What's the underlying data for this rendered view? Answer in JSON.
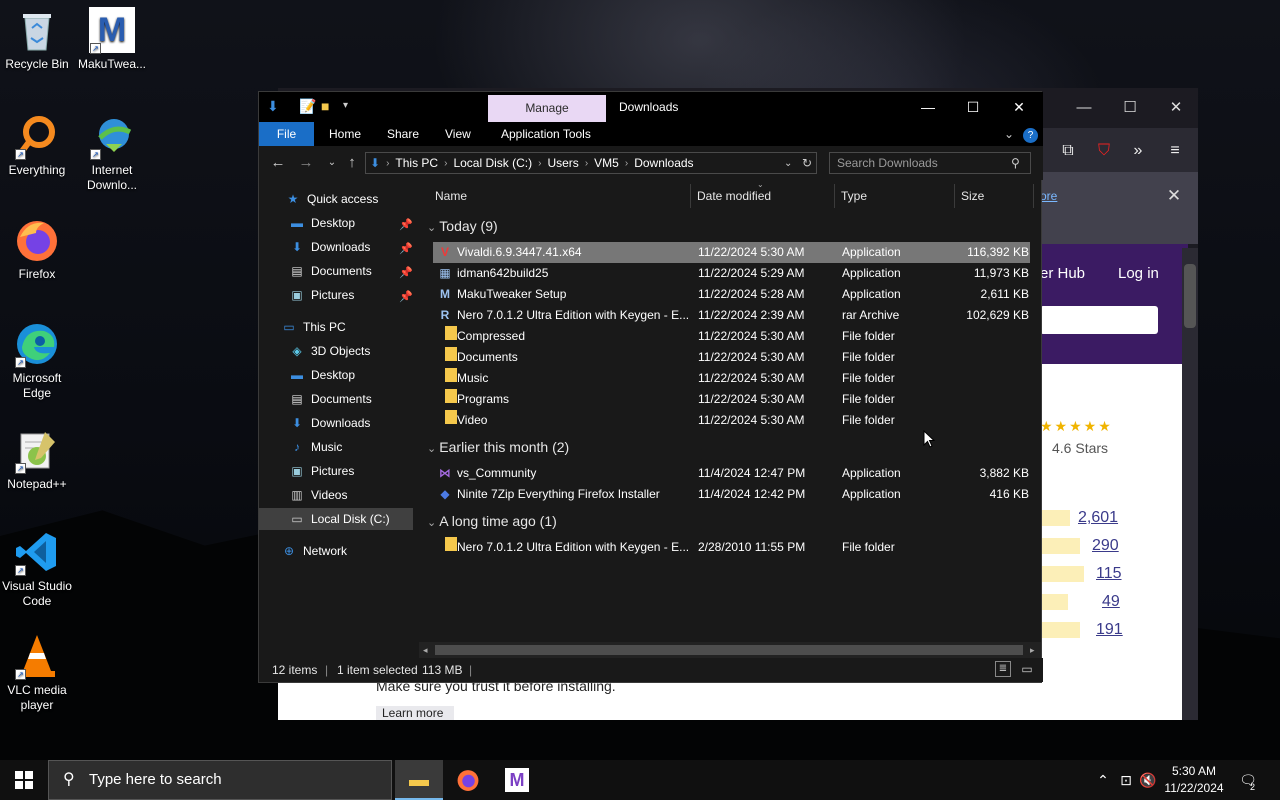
{
  "desktop": {
    "icons": [
      {
        "label": "Recycle Bin",
        "glyph": "🗑"
      },
      {
        "label": "MakuTwea...",
        "glyph": "M"
      },
      {
        "label": "Everything",
        "glyph": "○"
      },
      {
        "label": "Internet Downlo...",
        "glyph": "⬇"
      },
      {
        "label": "Firefox",
        "glyph": "🦊"
      },
      {
        "label": "Microsoft Edge",
        "glyph": "e"
      },
      {
        "label": "Notepad++",
        "glyph": "✎"
      },
      {
        "label": "Visual Studio Code",
        "glyph": "⟩"
      },
      {
        "label": "VLC media player",
        "glyph": "▲"
      }
    ]
  },
  "browser": {
    "more_link": "ore",
    "hub_text": "er Hub",
    "login": "Log in",
    "rating_stars": "★★★★★",
    "rating_text": "4.6 Stars",
    "counts": [
      "2,601",
      "290",
      "115",
      "49",
      "191"
    ],
    "footer_text": "Make sure you trust it before installing.",
    "learn_more": "Learn more"
  },
  "explorer": {
    "manage_tab": "Manage",
    "title": "Downloads",
    "ribbon_tabs": [
      "File",
      "Home",
      "Share",
      "View",
      "Application Tools"
    ],
    "breadcrumb": [
      "This PC",
      "Local Disk (C:)",
      "Users",
      "VM5",
      "Downloads"
    ],
    "search_placeholder": "Search Downloads",
    "nav": {
      "quick_access": "Quick access",
      "quick_items": [
        "Desktop",
        "Downloads",
        "Documents",
        "Pictures"
      ],
      "this_pc": "This PC",
      "pc_items": [
        "3D Objects",
        "Desktop",
        "Documents",
        "Downloads",
        "Music",
        "Pictures",
        "Videos",
        "Local Disk (C:)"
      ],
      "network": "Network"
    },
    "columns": {
      "name": "Name",
      "date": "Date modified",
      "type": "Type",
      "size": "Size"
    },
    "groups": [
      {
        "title": "Today (9)",
        "rows": [
          {
            "name": "Vivaldi.6.9.3447.41.x64",
            "date": "11/22/2024 5:30 AM",
            "type": "Application",
            "size": "116,392 KB",
            "icon": "V",
            "selected": true
          },
          {
            "name": "idman642build25",
            "date": "11/22/2024 5:29 AM",
            "type": "Application",
            "size": "11,973 KB",
            "icon": "▦",
            "selected": false
          },
          {
            "name": "MakuTweaker Setup",
            "date": "11/22/2024 5:28 AM",
            "type": "Application",
            "size": "2,611 KB",
            "icon": "M",
            "selected": false
          },
          {
            "name": "Nero 7.0.1.2 Ultra Edition with Keygen - E...",
            "date": "11/22/2024 2:39 AM",
            "type": "rar Archive",
            "size": "102,629 KB",
            "icon": "R",
            "selected": false
          },
          {
            "name": "Compressed",
            "date": "11/22/2024 5:30 AM",
            "type": "File folder",
            "size": "",
            "icon": "folder",
            "selected": false
          },
          {
            "name": "Documents",
            "date": "11/22/2024 5:30 AM",
            "type": "File folder",
            "size": "",
            "icon": "folder",
            "selected": false
          },
          {
            "name": "Music",
            "date": "11/22/2024 5:30 AM",
            "type": "File folder",
            "size": "",
            "icon": "folder",
            "selected": false
          },
          {
            "name": "Programs",
            "date": "11/22/2024 5:30 AM",
            "type": "File folder",
            "size": "",
            "icon": "folder",
            "selected": false
          },
          {
            "name": "Video",
            "date": "11/22/2024 5:30 AM",
            "type": "File folder",
            "size": "",
            "icon": "folder",
            "selected": false
          }
        ]
      },
      {
        "title": "Earlier this month (2)",
        "rows": [
          {
            "name": "vs_Community",
            "date": "11/4/2024 12:47 PM",
            "type": "Application",
            "size": "3,882 KB",
            "icon": "⋈",
            "selected": false
          },
          {
            "name": "Ninite 7Zip Everything Firefox Installer",
            "date": "11/4/2024 12:42 PM",
            "type": "Application",
            "size": "416 KB",
            "icon": "◆",
            "selected": false
          }
        ]
      },
      {
        "title": "A long time ago (1)",
        "rows": [
          {
            "name": "Nero 7.0.1.2 Ultra Edition with Keygen - E...",
            "date": "2/28/2010 11:55 PM",
            "type": "File folder",
            "size": "",
            "icon": "folder",
            "selected": false
          }
        ]
      }
    ],
    "status": {
      "count": "12 items",
      "selected": "1 item selected",
      "size": "113 MB"
    }
  },
  "taskbar": {
    "search_placeholder": "Type here to search",
    "time": "5:30 AM",
    "date": "11/22/2024",
    "notification_count": "2"
  },
  "colors": {
    "accent": "#1a6ec7",
    "manage_tab": "#e9d8f4",
    "folder": "#f5c84c",
    "selection": "#777777"
  }
}
